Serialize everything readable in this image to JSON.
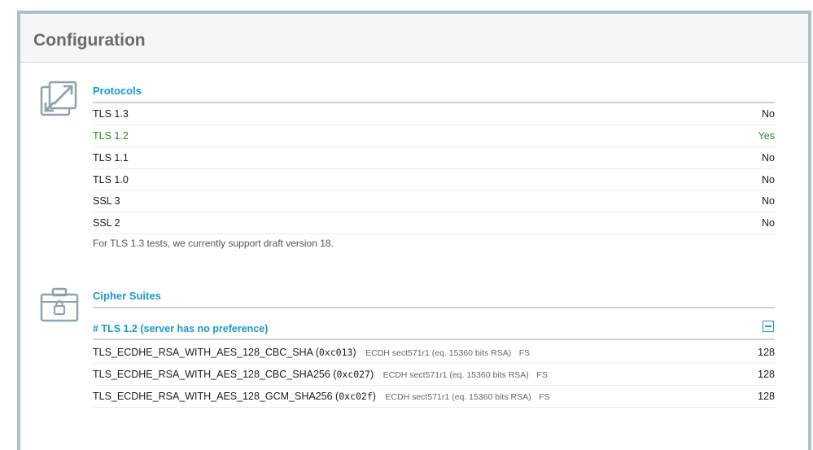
{
  "page": {
    "title": "Configuration"
  },
  "protocols": {
    "title": "Protocols",
    "icon": "resize-arrows-icon",
    "rows": [
      {
        "label": "TLS 1.3",
        "value": "No"
      },
      {
        "label": "TLS 1.2",
        "value": "Yes"
      },
      {
        "label": "TLS 1.1",
        "value": "No"
      },
      {
        "label": "TLS 1.0",
        "value": "No"
      },
      {
        "label": "SSL 3",
        "value": "No"
      },
      {
        "label": "SSL 2",
        "value": "No"
      }
    ],
    "note": "For TLS 1.3 tests, we currently support draft version 18."
  },
  "ciphers": {
    "title": "Cipher Suites",
    "icon": "locked-toolbox-icon",
    "group_label": "# TLS 1.2 (server has no preference)",
    "rows": [
      {
        "name": "TLS_ECDHE_RSA_WITH_AES_128_CBC_SHA",
        "code": "0xc013",
        "kex": "ECDH sect571r1 (eq. 15360 bits RSA)",
        "fs": "FS",
        "bits": "128"
      },
      {
        "name": "TLS_ECDHE_RSA_WITH_AES_128_CBC_SHA256",
        "code": "0xc027",
        "kex": "ECDH sect571r1 (eq. 15360 bits RSA)",
        "fs": "FS",
        "bits": "128"
      },
      {
        "name": "TLS_ECDHE_RSA_WITH_AES_128_GCM_SHA256",
        "code": "0xc02f",
        "kex": "ECDH sect571r1 (eq. 15360 bits RSA)",
        "fs": "FS",
        "bits": "128"
      }
    ]
  },
  "colors": {
    "accent": "#1a97cf",
    "positive": "#2a8a2a",
    "frame": "#a9c4c4"
  }
}
